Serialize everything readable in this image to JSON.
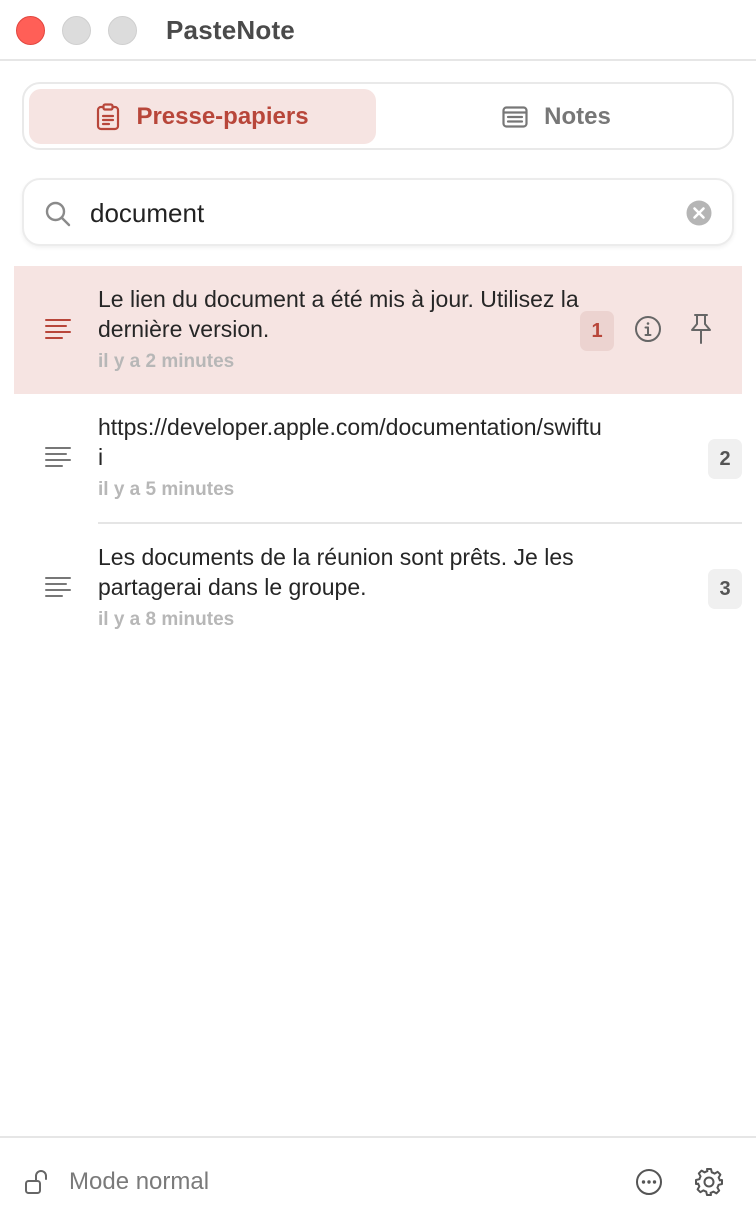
{
  "window": {
    "title": "PasteNote"
  },
  "tabs": [
    {
      "label": "Presse-papiers",
      "icon": "clipboard-icon",
      "active": true
    },
    {
      "label": "Notes",
      "icon": "note-icon",
      "active": false
    }
  ],
  "search": {
    "value": "document",
    "placeholder": ""
  },
  "items": [
    {
      "text": "Le lien du document a été mis à jour. Utilisez la dernière version.",
      "time": "il y a 2 minutes",
      "index": "1",
      "selected": true
    },
    {
      "text": "https://developer.apple.com/documentation/swiftui",
      "time": "il y a 5 minutes",
      "index": "2",
      "selected": false
    },
    {
      "text": "Les documents de la réunion sont prêts. Je les partagerai dans le groupe.",
      "time": "il y a 8 minutes",
      "index": "3",
      "selected": false
    }
  ],
  "footer": {
    "mode_label": "Mode normal"
  },
  "colors": {
    "accent": "#b8463a",
    "selection": "#f6e4e2",
    "close": "#ff5f57"
  }
}
